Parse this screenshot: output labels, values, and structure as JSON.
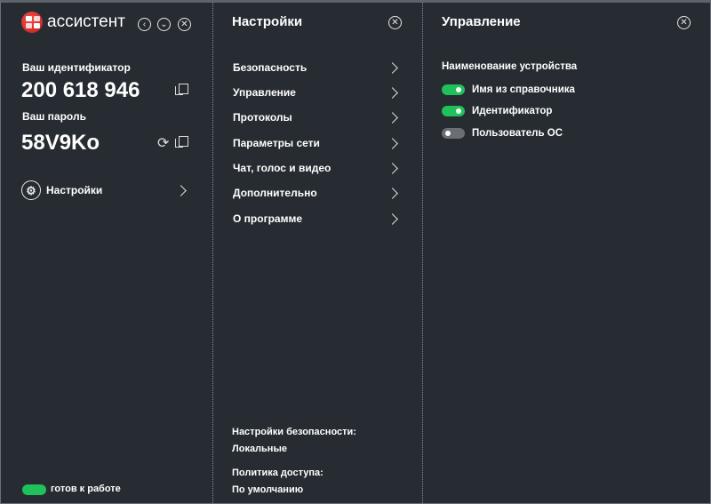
{
  "app": {
    "title": "ассистент",
    "brand_color": "#d92b2b",
    "accent": "#1ec15a"
  },
  "left": {
    "id_label": "Ваш идентификатор",
    "id_value": "200 618 946",
    "pwd_label": "Ваш пароль",
    "pwd_value": "58V9Ko",
    "settings_label": "Настройки",
    "status": "готов к работе"
  },
  "settings": {
    "title": "Настройки",
    "items": [
      "Безопасность",
      "Управление",
      "Протоколы",
      "Параметры сети",
      "Чат, голос и видео",
      "Дополнительно",
      "О программе"
    ],
    "security_label": "Настройки безопасности:",
    "security_value": "Локальные",
    "policy_label": "Политика доступа:",
    "policy_value": "По умолчанию"
  },
  "control": {
    "title": "Управление",
    "section": "Наименование устройства",
    "options": [
      {
        "label": "Имя из справочника",
        "on": true
      },
      {
        "label": "Идентификатор",
        "on": true
      },
      {
        "label": "Пользователь ОС",
        "on": false
      }
    ]
  }
}
